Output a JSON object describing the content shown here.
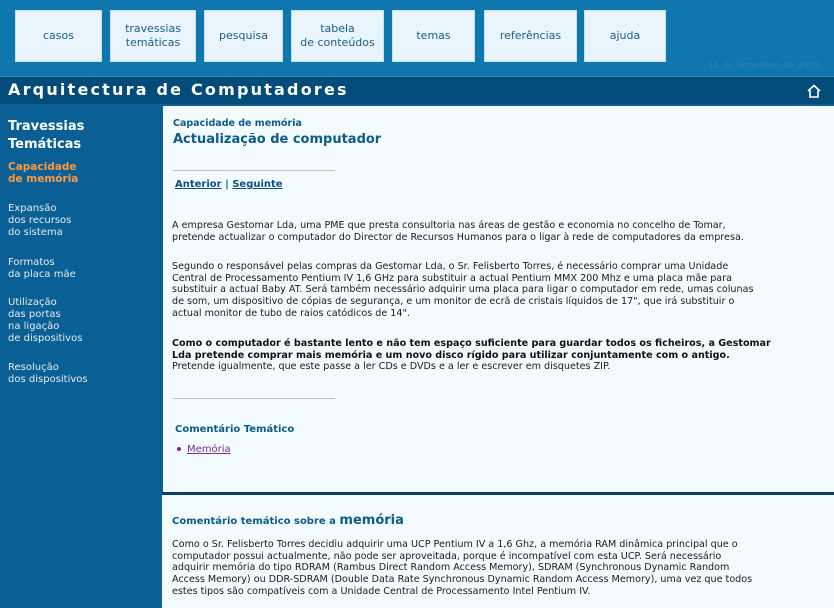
{
  "nav": {
    "items": [
      {
        "label_lines": [
          "casos"
        ]
      },
      {
        "label_lines": [
          "travessias",
          "temáticas"
        ]
      },
      {
        "label_lines": [
          "pesquisa"
        ]
      },
      {
        "label_lines": [
          "tabela",
          "de conteúdos"
        ]
      },
      {
        "label_lines": [
          "temas"
        ]
      },
      {
        "label_lines": [
          "referências"
        ]
      },
      {
        "label_lines": [
          "ajuda"
        ]
      }
    ],
    "date": "14 de Setembro de 2005"
  },
  "header": {
    "title": "Arquitectura de Computadores",
    "home_icon": "home-icon"
  },
  "sidebar": {
    "heading_lines": [
      "Travessias",
      "Temáticas"
    ],
    "items": [
      {
        "lines": [
          "Capacidade",
          "de memória"
        ],
        "active": true
      },
      {
        "lines": [
          "Expansão",
          "dos recursos",
          "do sistema"
        ],
        "active": false
      },
      {
        "lines": [
          "Formatos",
          "da placa mãe"
        ],
        "active": false
      },
      {
        "lines": [
          "Utilização",
          "das portas",
          "na ligação",
          "de dispositivos"
        ],
        "active": false
      },
      {
        "lines": [
          "Resolução",
          "dos dispositivos"
        ],
        "active": false
      }
    ]
  },
  "main": {
    "breadcrumb": "Capacidade de memória",
    "title": "Actualização de computador",
    "pager": {
      "prev": "Anterior",
      "sep": "|",
      "next": "Seguinte"
    },
    "paragraphs": [
      {
        "lines": [
          "A empresa Gestomar Lda, uma PME que presta consultoria nas áreas de gestão e economia no concelho de Tomar,",
          "pretende actualizar o computador do Director de Recursos Humanos para o ligar à rede de computadores da empresa."
        ]
      },
      {
        "lines": [
          "Segundo o responsável pelas compras da Gestomar Lda, o Sr. Felisberto Torres, é necessário comprar uma Unidade",
          "Central de Processamento Pentium IV 1,6 GHz para substituir a actual Pentium MMX 200 Mhz e uma placa mãe para",
          "substituir a actual Baby AT. Será também necessário adquirir uma placa para ligar o computador em rede, umas colunas",
          "de som, um dispositivo de cópias de segurança, e um monitor de ecrã de cristais líquidos de 17\", que irá substituir o",
          "actual monitor de tubo de raios catódicos de 14\"."
        ]
      },
      {
        "bold_lines": [
          "Como o computador é bastante lento e não tem espaço suficiente para guardar todos os ficheiros, a Gestomar",
          "Lda pretende comprar mais memória e um novo disco rígido para utilizar conjuntamente com o antigo."
        ],
        "lines": [
          "Pretende igualmente, que este passe a ler CDs e DVDs e a ler e escrever em disquetes ZIP."
        ]
      }
    ],
    "tema_heading": "Comentário Temático",
    "tema_link": "Memória"
  },
  "lower": {
    "heading_prefix": "Comentário temático sobre a ",
    "heading_term": "memória",
    "lines": [
      "Como o Sr. Felisberto Torres decidiu adquirir uma UCP Pentium IV a 1,6 Ghz, a memória RAM dinâmica principal que o",
      "computador possui actualmente, não pode ser aproveitada, porque é incompatível com esta UCP. Será necessário",
      "adquirir memória do tipo RDRAM (Rambus Direct Random Access Memory), SDRAM (Synchronous Dynamic Random",
      "Access Memory) ou DDR-SDRAM (Double Data Rate Synchronous Dynamic Random Access Memory), uma vez que todos",
      "estes tipos são compatíveis com a Unidade Central de Processamento Intel Pentium IV."
    ]
  }
}
